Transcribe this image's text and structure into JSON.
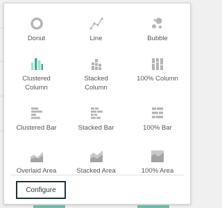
{
  "chart_types": [
    {
      "label": "Donut",
      "icon": "donut-chart-icon",
      "selected": false
    },
    {
      "label": "Line",
      "icon": "line-chart-icon",
      "selected": false
    },
    {
      "label": "Bubble",
      "icon": "bubble-chart-icon",
      "selected": false
    },
    {
      "label": "Clustered\nColumn",
      "icon": "clustered-column-chart-icon",
      "selected": true
    },
    {
      "label": "Stacked\nColumn",
      "icon": "stacked-column-chart-icon",
      "selected": false
    },
    {
      "label": "100% Column",
      "icon": "percent-column-chart-icon",
      "selected": false
    },
    {
      "label": "Clustered Bar",
      "icon": "clustered-bar-chart-icon",
      "selected": false
    },
    {
      "label": "Stacked Bar",
      "icon": "stacked-bar-chart-icon",
      "selected": false
    },
    {
      "label": "100% Bar",
      "icon": "percent-bar-chart-icon",
      "selected": false
    },
    {
      "label": "Overlaid Area",
      "icon": "overlaid-area-chart-icon",
      "selected": false
    },
    {
      "label": "Stacked Area",
      "icon": "stacked-area-chart-icon",
      "selected": false
    },
    {
      "label": "100% Area",
      "icon": "percent-area-chart-icon",
      "selected": false
    }
  ],
  "configure_label": "Configure",
  "colors": {
    "icon_gray": "#b5b5b5",
    "icon_selected": "#3dae96",
    "icon_selected_light": "#a8dccf",
    "button_border": "#1f2f3c",
    "accent_bar": "#6fc3ae"
  }
}
